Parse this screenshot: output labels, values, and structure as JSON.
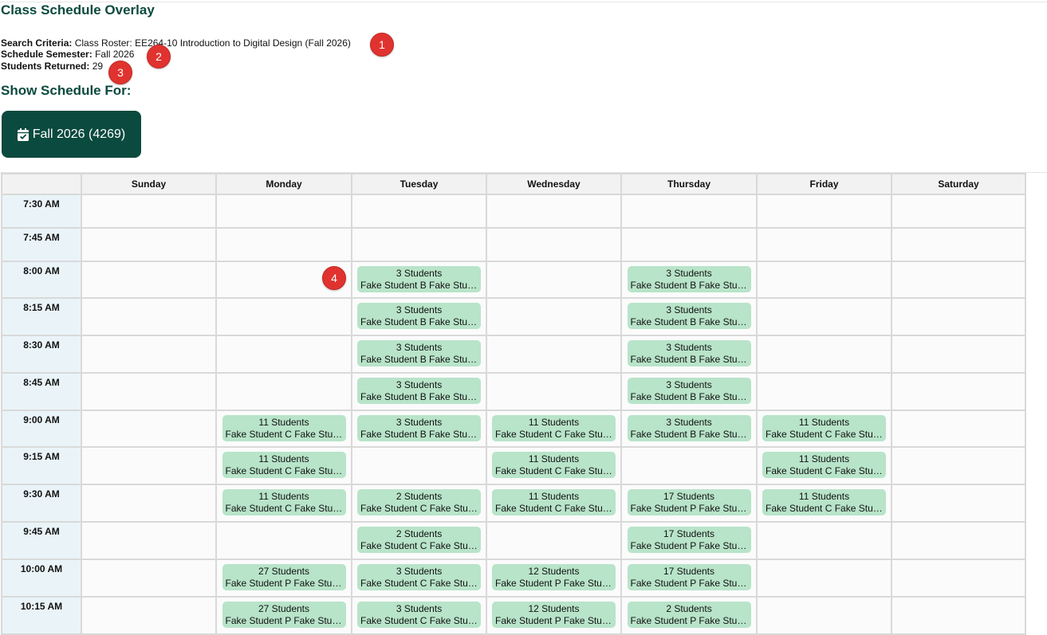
{
  "header": {
    "title": "Class Schedule Overlay",
    "search_criteria_label": "Search Criteria:",
    "search_criteria_value": "Class Roster: EE264-10 Introduction to Digital Design (Fall 2026)",
    "semester_label": "Schedule Semester:",
    "semester_value": "Fall 2026",
    "students_label": "Students Returned:",
    "students_value": "29"
  },
  "show_for": {
    "title": "Show Schedule For:",
    "button_label": "Fall 2026 (4269)",
    "button_icon": "calendar-check-icon"
  },
  "markers": [
    "1",
    "2",
    "3",
    "4"
  ],
  "schedule": {
    "days": [
      "Sunday",
      "Monday",
      "Tuesday",
      "Wednesday",
      "Thursday",
      "Friday",
      "Saturday"
    ],
    "rows": [
      {
        "time": "7:30 AM",
        "cells": [
          null,
          null,
          null,
          null,
          null,
          null,
          null
        ]
      },
      {
        "time": "7:45 AM",
        "cells": [
          null,
          null,
          null,
          null,
          null,
          null,
          null
        ]
      },
      {
        "time": "8:00 AM",
        "cells": [
          null,
          null,
          {
            "count": "3 Students",
            "names": "Fake Student B Fake Student C Fake Student D"
          },
          null,
          {
            "count": "3 Students",
            "names": "Fake Student B Fake Student C Fake Student D"
          },
          null,
          null
        ]
      },
      {
        "time": "8:15 AM",
        "cells": [
          null,
          null,
          {
            "count": "3 Students",
            "names": "Fake Student B Fake Student C Fake Student D"
          },
          null,
          {
            "count": "3 Students",
            "names": "Fake Student B Fake Student C Fake Student D"
          },
          null,
          null
        ]
      },
      {
        "time": "8:30 AM",
        "cells": [
          null,
          null,
          {
            "count": "3 Students",
            "names": "Fake Student B Fake Student C Fake Student D"
          },
          null,
          {
            "count": "3 Students",
            "names": "Fake Student B Fake Student C Fake Student D"
          },
          null,
          null
        ]
      },
      {
        "time": "8:45 AM",
        "cells": [
          null,
          null,
          {
            "count": "3 Students",
            "names": "Fake Student B Fake Student C Fake Student D"
          },
          null,
          {
            "count": "3 Students",
            "names": "Fake Student B Fake Student C Fake Student D"
          },
          null,
          null
        ]
      },
      {
        "time": "9:00 AM",
        "cells": [
          null,
          {
            "count": "11 Students",
            "names": "Fake Student C Fake Student D Fake Student E"
          },
          {
            "count": "3 Students",
            "names": "Fake Student B Fake Student C Fake Student D"
          },
          {
            "count": "11 Students",
            "names": "Fake Student C Fake Student D Fake Student E"
          },
          {
            "count": "3 Students",
            "names": "Fake Student B Fake Student C Fake Student D"
          },
          {
            "count": "11 Students",
            "names": "Fake Student C Fake Student D Fake Student E"
          },
          null
        ]
      },
      {
        "time": "9:15 AM",
        "cells": [
          null,
          {
            "count": "11 Students",
            "names": "Fake Student C Fake Student D Fake Student E"
          },
          null,
          {
            "count": "11 Students",
            "names": "Fake Student C Fake Student D Fake Student E"
          },
          null,
          {
            "count": "11 Students",
            "names": "Fake Student C Fake Student D Fake Student E"
          },
          null
        ]
      },
      {
        "time": "9:30 AM",
        "cells": [
          null,
          {
            "count": "11 Students",
            "names": "Fake Student C Fake Student D Fake Student E"
          },
          {
            "count": "2 Students",
            "names": "Fake Student C Fake Student D"
          },
          {
            "count": "11 Students",
            "names": "Fake Student C Fake Student D Fake Student E"
          },
          {
            "count": "17 Students",
            "names": "Fake Student P Fake Student Q Fake Student R"
          },
          {
            "count": "11 Students",
            "names": "Fake Student C Fake Student D Fake Student E"
          },
          null
        ]
      },
      {
        "time": "9:45 AM",
        "cells": [
          null,
          null,
          {
            "count": "2 Students",
            "names": "Fake Student C Fake Student D"
          },
          null,
          {
            "count": "17 Students",
            "names": "Fake Student P Fake Student Q Fake Student R"
          },
          null,
          null
        ]
      },
      {
        "time": "10:00 AM",
        "cells": [
          null,
          {
            "count": "27 Students",
            "names": "Fake Student P Fake Student Q Fake Student R"
          },
          {
            "count": "3 Students",
            "names": "Fake Student C Fake Student D Fake Student E"
          },
          {
            "count": "12 Students",
            "names": "Fake Student P Fake Student Q Fake Student R"
          },
          {
            "count": "17 Students",
            "names": "Fake Student P Fake Student Q Fake Student R"
          },
          null,
          null
        ]
      },
      {
        "time": "10:15 AM",
        "cells": [
          null,
          {
            "count": "27 Students",
            "names": "Fake Student P Fake Student Q Fake Student R"
          },
          {
            "count": "3 Students",
            "names": "Fake Student C Fake Student D Fake Student E"
          },
          {
            "count": "12 Students",
            "names": "Fake Student P Fake Student Q Fake Student R"
          },
          {
            "count": "2 Students",
            "names": "Fake Student P Fake Student Q"
          },
          null,
          null
        ]
      }
    ]
  }
}
